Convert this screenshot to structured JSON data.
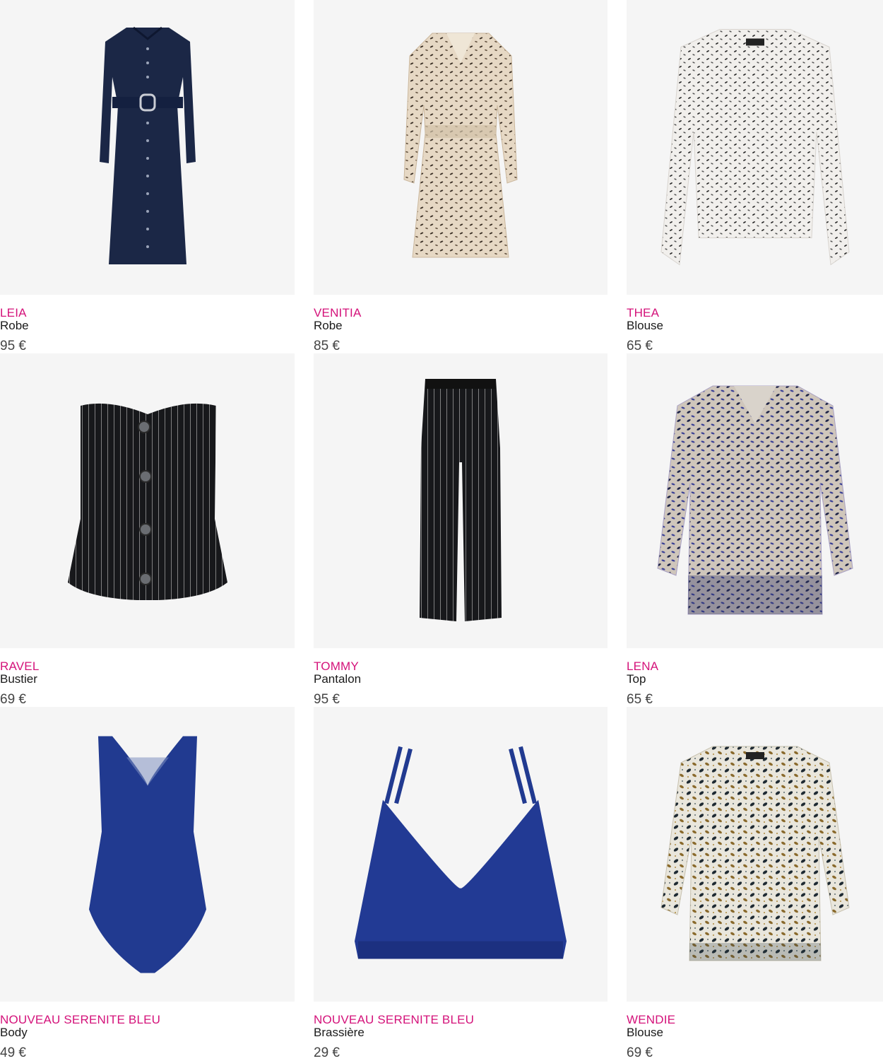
{
  "colors": {
    "brand_accent": "#d4127a",
    "tile_background": "#f5f5f5",
    "text_dark": "#1a1a1a",
    "price_text": "#444444"
  },
  "products": [
    {
      "name": "LEIA",
      "category": "Robe",
      "price": "95 €",
      "image_icon": "navy-shirt-dress-image"
    },
    {
      "name": "VENITIA",
      "category": "Robe",
      "price": "85 €",
      "image_icon": "beige-print-dress-image"
    },
    {
      "name": "THEA",
      "category": "Blouse",
      "price": "65 €",
      "image_icon": "white-print-blouse-image"
    },
    {
      "name": "RAVEL",
      "category": "Bustier",
      "price": "69 €",
      "image_icon": "black-pinstripe-bustier-image"
    },
    {
      "name": "TOMMY",
      "category": "Pantalon",
      "price": "95 €",
      "image_icon": "black-pinstripe-trousers-image"
    },
    {
      "name": "LENA",
      "category": "Top",
      "price": "65 €",
      "image_icon": "blue-print-top-image"
    },
    {
      "name": "NOUVEAU SERENITE BLEU",
      "category": "Body",
      "price": "49 €",
      "image_icon": "blue-bodysuit-image"
    },
    {
      "name": "NOUVEAU SERENITE BLEU",
      "category": "Brassière",
      "price": "29 €",
      "image_icon": "blue-bralette-image"
    },
    {
      "name": "WENDIE",
      "category": "Blouse",
      "price": "69 €",
      "image_icon": "leopard-print-blouse-image"
    }
  ]
}
